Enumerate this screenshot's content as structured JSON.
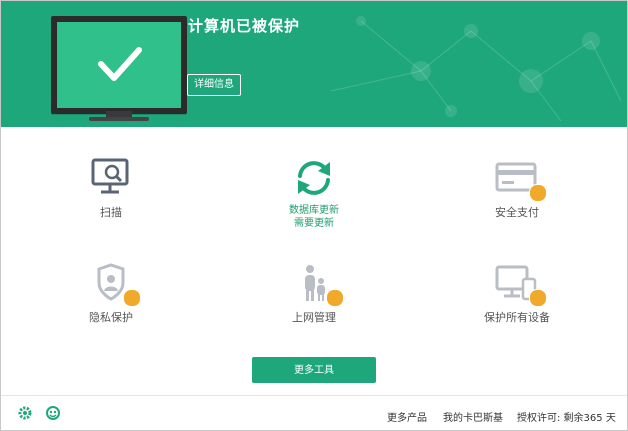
{
  "header": {
    "title": "计算机已被保护",
    "details_label": "详细信息"
  },
  "tools": [
    {
      "label": "扫描",
      "icon": "scan-monitor-icon",
      "premium": false
    },
    {
      "label": "数据库更新",
      "sublabel": "需要更新",
      "icon": "update-refresh-icon",
      "premium": false
    },
    {
      "label": "安全支付",
      "icon": "credit-card-icon",
      "premium": true
    },
    {
      "label": "隐私保护",
      "icon": "privacy-shield-icon",
      "premium": true
    },
    {
      "label": "上网管理",
      "icon": "parental-control-icon",
      "premium": true
    },
    {
      "label": "保护所有设备",
      "icon": "devices-icon",
      "premium": true
    }
  ],
  "more_tools_label": "更多工具",
  "footer": {
    "links": [
      "更多产品",
      "我的卡巴斯基",
      "授权许可: 剩余365 天"
    ],
    "icons": [
      "settings-gear-icon",
      "support-agent-icon"
    ]
  },
  "colors": {
    "brand_green": "#1da77b",
    "monitor_green": "#2fc08b",
    "crown": "#f0a92a"
  }
}
